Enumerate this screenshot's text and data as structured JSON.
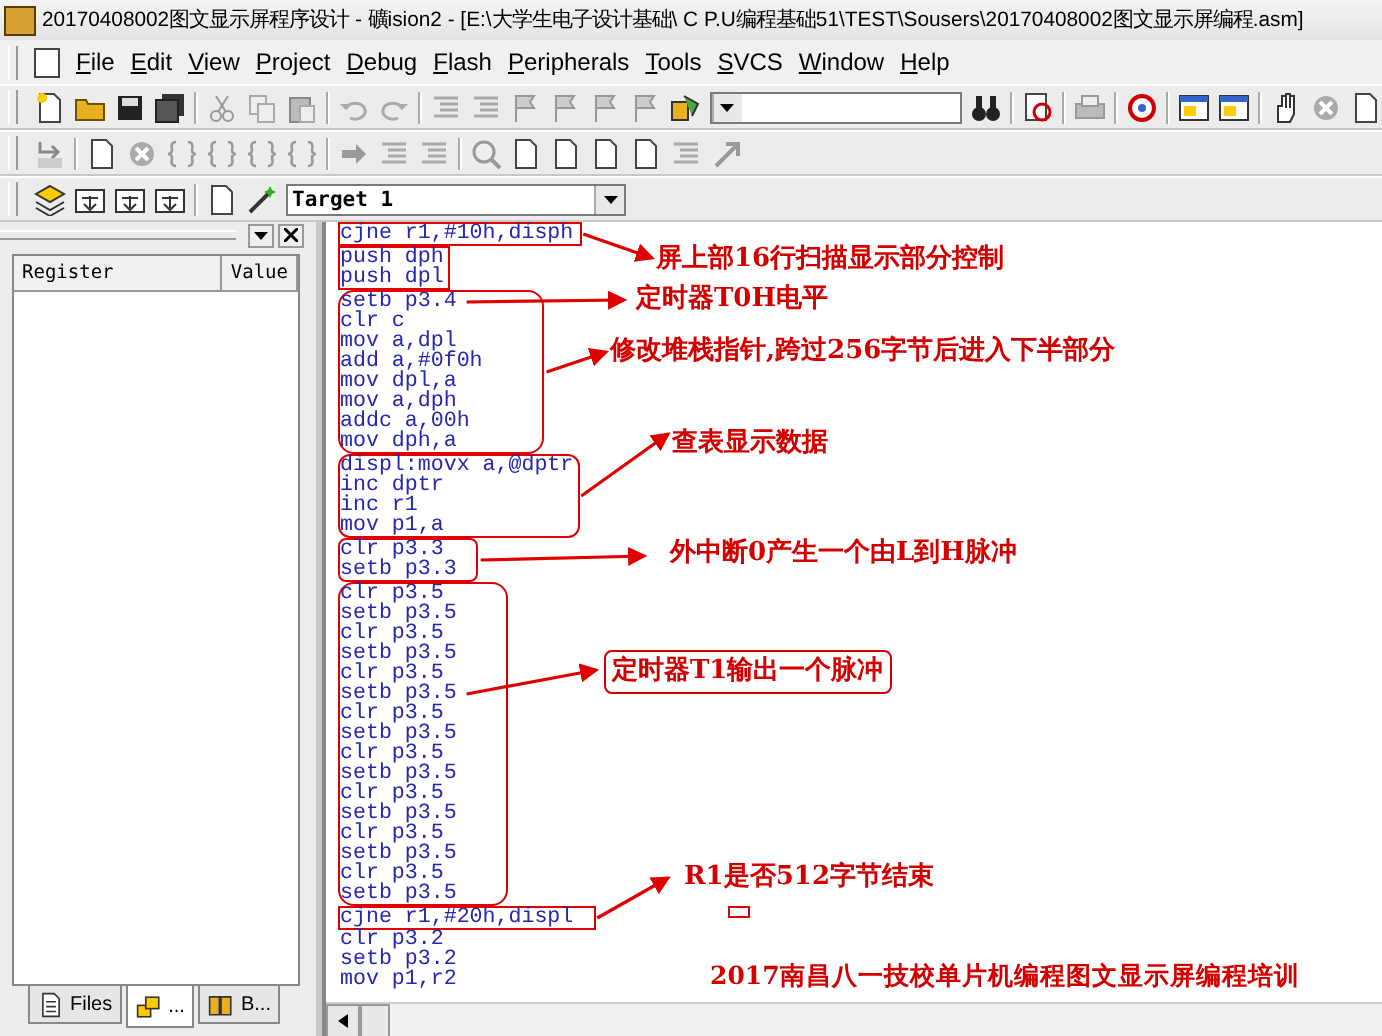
{
  "window": {
    "title": "20170408002图文显示屏程序设计  - 礦ision2 - [E:\\大学生电子设计基础\\ C P.U编程基础51\\TEST\\Sousers\\20170408002图文显示屏编程.asm]"
  },
  "menu": [
    "File",
    "Edit",
    "View",
    "Project",
    "Debug",
    "Flash",
    "Peripherals",
    "Tools",
    "SVCS",
    "Window",
    "Help"
  ],
  "target_select": {
    "value": "Target 1"
  },
  "register_panel": {
    "columns": [
      "Register",
      "Value"
    ],
    "tabs": [
      {
        "label": "Files",
        "selected": false
      },
      {
        "label": "...",
        "selected": true
      },
      {
        "label": "B...",
        "selected": false
      }
    ]
  },
  "code_lines": [
    "cjne r1,#10h,disph",
    "push dph",
    "push dpl",
    "setb p3.4",
    "clr c",
    "mov a,dpl",
    "add a,#0f0h",
    "mov dpl,a",
    "mov a,dph",
    "addc a,00h",
    "mov dph,a",
    "displ:movx a,@dptr",
    "inc dptr",
    "inc r1",
    "mov p1,a",
    "clr p3.3",
    "setb p3.3",
    "clr p3.5",
    "setb p3.5",
    "clr p3.5",
    "setb p3.5",
    "clr p3.5",
    "setb p3.5",
    "clr p3.5",
    "setb p3.5",
    "clr p3.5",
    "setb p3.5",
    "clr p3.5",
    "setb p3.5",
    "clr p3.5",
    "setb p3.5",
    "clr p3.5",
    "setb p3.5",
    "cjne r1,#20h,displ",
    "clr p3.2",
    "setb p3.2",
    "mov p1,r2"
  ],
  "annotations": [
    {
      "text": "屏上部16行扫描显示部分控制",
      "boxed": false
    },
    {
      "text": "定时器T0H电平",
      "boxed": false
    },
    {
      "text": "修改堆栈指针,跨过256字节后进入下半部分",
      "boxed": false
    },
    {
      "text": "查表显示数据",
      "boxed": false
    },
    {
      "text": "外中断0产生一个由L到H脉冲",
      "boxed": false
    },
    {
      "text": "定时器T1输出一个脉冲",
      "boxed": true
    },
    {
      "text": "R1是否512字节结束",
      "boxed": false
    }
  ],
  "footer_caption": "2017南昌八一技校单片机编程图文显示屏编程培训"
}
